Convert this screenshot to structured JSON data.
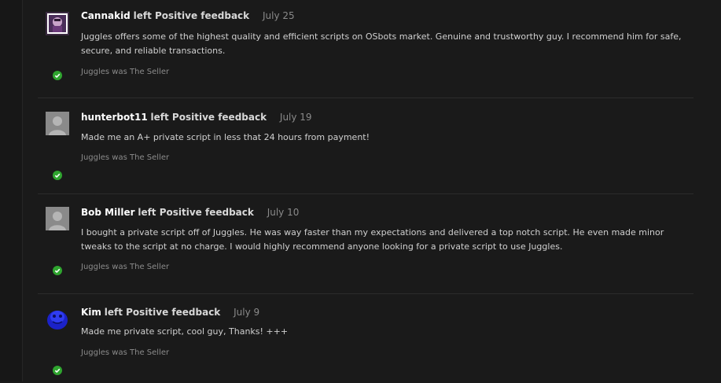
{
  "feedback": [
    {
      "username": "Cannakid",
      "action": "left Positive feedback",
      "date": "July 25",
      "message": "Juggles offers some of the highest quality and efficient scripts on OSbots market. Genuine and trustworthy guy. I recommend him for safe, secure, and reliable transactions.",
      "role": "Juggles was The Seller",
      "avatar_icon": "custom-avatar-icon",
      "status_icon": "check-circle-icon"
    },
    {
      "username": "hunterbot11",
      "action": "left Positive feedback",
      "date": "July 19",
      "message": "Made me an A+ private script in less that 24 hours from payment!",
      "role": "Juggles was The Seller",
      "avatar_icon": "default-avatar-icon",
      "status_icon": "check-circle-icon"
    },
    {
      "username": "Bob Miller",
      "action": "left Positive feedback",
      "date": "July 10",
      "message": "I bought a private script off of Juggles. He was way faster than my expectations and delivered a top notch script. He even made minor tweaks to the script at no charge. I would highly recommend anyone looking for a private script to use Juggles.",
      "role": "Juggles was The Seller",
      "avatar_icon": "default-avatar-icon",
      "status_icon": "check-circle-icon"
    },
    {
      "username": "Kim",
      "action": "left Positive feedback",
      "date": "July 9",
      "message": "Made me private script, cool guy, Thanks! +++",
      "role": "Juggles was The Seller",
      "avatar_icon": "custom-avatar-icon",
      "status_icon": "check-circle-icon"
    }
  ],
  "colors": {
    "background": "#1a1a1a",
    "username": "#ffffff",
    "action": "#d8d8d8",
    "date": "#8a8a8a",
    "message": "#d0d0d0",
    "positive": "#2fa52f"
  }
}
